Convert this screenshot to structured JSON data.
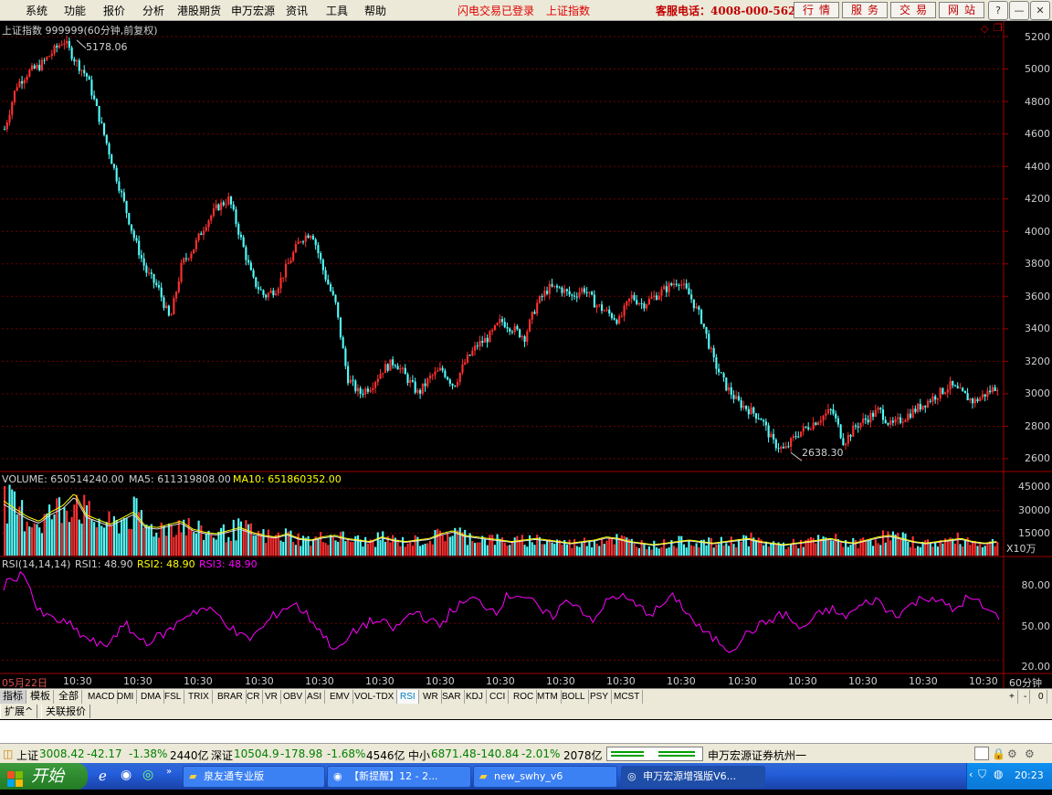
{
  "menu": {
    "items": [
      "系统",
      "功能",
      "报价",
      "分析",
      "港股期货",
      "申万宏源",
      "资讯",
      "工具",
      "帮助"
    ],
    "login_status": "闪电交易已登录",
    "current_index": "上证指数",
    "service_phone": "客服电话：4008-000-562",
    "tabs": [
      "行情",
      "服务",
      "交易",
      "网站"
    ]
  },
  "chart": {
    "title": "上证指数 999999(60分钟,前复权)",
    "high_label": "5178.06",
    "low_label": "2638.30",
    "price_ticks": [
      "5200",
      "5000",
      "4800",
      "4600",
      "4400",
      "4200",
      "4000",
      "3800",
      "3600",
      "3400",
      "3200",
      "3000",
      "2800",
      "2600"
    ],
    "volume": {
      "label": "VOLUME: 650514240.00",
      "ma5": "MA5: 611319808.00",
      "ma10": "MA10: 651860352.00",
      "ticks": [
        "45000",
        "30000",
        "15000"
      ],
      "unit": "X10万"
    },
    "rsi": {
      "label": "RSI(14,14,14)",
      "rsi1": "RSI1: 48.90",
      "rsi2": "RSI2: 48.90",
      "rsi3": "RSI3: 48.90",
      "ticks": [
        "80.00",
        "50.00",
        "20.00"
      ]
    },
    "x_ticks": [
      "05月22日",
      "10:30",
      "10:30",
      "10:30",
      "10:30",
      "10:30",
      "10:30",
      "10:30",
      "10:30",
      "10:30",
      "10:30",
      "10:30",
      "10:30",
      "10:30",
      "10:30",
      "10:30",
      "10:30"
    ],
    "period": "60分钟"
  },
  "indicators": [
    "指标",
    "模板",
    "全部",
    "MACD",
    "DMI",
    "DMA",
    "FSL",
    "TRIX",
    "BRAR",
    "CR",
    "VR",
    "OBV",
    "ASI",
    "EMV",
    "VOL-TDX",
    "RSI",
    "WR",
    "SAR",
    "KDJ",
    "CCI",
    "ROC",
    "MTM",
    "BOLL",
    "PSY",
    "MCST"
  ],
  "indicator_controls": [
    "+",
    "-",
    "0"
  ],
  "ext_tabs": [
    "扩展^",
    "关联报价"
  ],
  "status": {
    "sh_label": "上证",
    "sh_value": "3008.42",
    "sh_change": "-42.17",
    "sh_pct": "-1.38%",
    "sh_amount": "2440亿",
    "sz_label": "深证",
    "sz_value": "10504.9",
    "sz_change": "-178.98",
    "sz_pct": "-1.68%",
    "sz_amount": "4546亿",
    "zx_label": "中小",
    "zx_value": "6871.48",
    "zx_change": "-140.84",
    "zx_pct": "-2.01%",
    "zx_amount": "2078亿",
    "broker": "申万宏源证券杭州一"
  },
  "taskbar": {
    "start": "开始",
    "tasks": [
      "泉友通专业版",
      "【新提醒】12 - 2...",
      "new_swhy_v6",
      "申万宏源增强版V6..."
    ],
    "clock": "20:23"
  },
  "chart_data": [
    {
      "type": "line",
      "title": "上证指数 999999(60分钟,前复权)",
      "ylim": [
        2600,
        5250
      ],
      "series": [
        {
          "name": "",
          "values": [
            4630,
            4900,
            4980,
            5020,
            5100,
            5178,
            5050,
            4950,
            4700,
            4450,
            4200,
            3950,
            3750,
            3650,
            3450,
            3800,
            3900,
            4050,
            4150,
            4200,
            3950,
            3700,
            3600,
            3650,
            3800,
            3950,
            4000,
            3750,
            3550,
            3100,
            3000,
            3050,
            3150,
            3200,
            3100,
            3000,
            3100,
            3150,
            3050,
            3200,
            3300,
            3350,
            3450,
            3400,
            3350,
            3550,
            3650,
            3650,
            3600,
            3650,
            3550,
            3500,
            3450,
            3600,
            3550,
            3600,
            3650,
            3700,
            3600,
            3450,
            3200,
            3050,
            2950,
            2900,
            2850,
            2700,
            2650,
            2750,
            2800,
            2850,
            2900,
            2700,
            2800,
            2850,
            2900,
            2800,
            2850,
            2900,
            2950,
            3000,
            3050,
            3000,
            2950,
            3000,
            3050
          ]
        }
      ],
      "annotations": [
        "5178.06",
        "2638.30"
      ]
    },
    {
      "type": "bar",
      "title": "VOLUME",
      "ylim": [
        0,
        50000
      ],
      "series": [
        {
          "name": "VOLUME",
          "values": [
            35000,
            30000,
            25000,
            22000,
            28000,
            32000,
            40000,
            26000,
            23000,
            20000,
            24000,
            28000,
            19000,
            18000,
            20000,
            22000,
            17000,
            15000,
            14000,
            16000,
            18000,
            15000,
            13000,
            12000,
            14000,
            11000,
            10000,
            12000,
            13000,
            11000,
            10000,
            9000,
            12000,
            10000,
            9000,
            10000,
            11000,
            14000,
            16000,
            13000,
            12000,
            11000,
            10000,
            9000,
            10000,
            11000,
            10000,
            9000,
            8000,
            9000,
            10000,
            12000,
            11000,
            9000,
            8000,
            7000,
            8000,
            9000,
            10000,
            9000,
            8000,
            9000,
            10000,
            11000,
            9000,
            8000,
            7000,
            8000,
            9000,
            10000,
            11000,
            9000,
            8000,
            10000,
            12000,
            13000,
            11000,
            9000,
            8000,
            9000,
            10000,
            11000,
            9000,
            8000,
            9000
          ]
        }
      ]
    },
    {
      "type": "line",
      "title": "RSI(14,14,14)",
      "ylim": [
        20,
        100
      ],
      "series": [
        {
          "name": "RSI",
          "values": [
            80,
            88,
            90,
            60,
            55,
            52,
            48,
            40,
            35,
            30,
            42,
            48,
            38,
            35,
            40,
            45,
            55,
            60,
            62,
            58,
            50,
            40,
            38,
            45,
            55,
            62,
            66,
            58,
            48,
            35,
            28,
            40,
            48,
            52,
            50,
            45,
            55,
            60,
            52,
            48,
            60,
            66,
            70,
            65,
            60,
            72,
            74,
            70,
            60,
            55,
            66,
            68,
            58,
            52,
            70,
            73,
            68,
            62,
            58,
            66,
            72,
            60,
            48,
            40,
            35,
            28,
            38,
            45,
            50,
            55,
            58,
            45,
            50,
            58,
            62,
            55,
            60,
            66,
            70,
            60,
            58,
            64,
            70,
            72,
            66,
            60,
            70,
            68,
            60,
            55
          ]
        }
      ]
    }
  ]
}
